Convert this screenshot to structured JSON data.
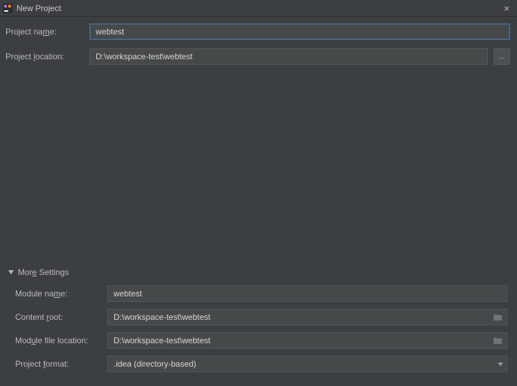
{
  "window": {
    "title": "New Project",
    "close_label": "×"
  },
  "form": {
    "project_name_label_pre": "Project na",
    "project_name_label_u": "m",
    "project_name_label_post": "e:",
    "project_name_value": "webtest",
    "project_location_label_pre": "Project ",
    "project_location_label_u": "l",
    "project_location_label_post": "ocation:",
    "project_location_value": "D:\\workspace-test\\webtest",
    "browse_label": "..."
  },
  "more": {
    "header_pre": "Mor",
    "header_u": "e",
    "header_post": " Settings",
    "module_name_label_pre": "Module na",
    "module_name_label_u": "m",
    "module_name_label_post": "e:",
    "module_name_value": "webtest",
    "content_root_label_pre": "Content ",
    "content_root_label_u": "r",
    "content_root_label_post": "oot:",
    "content_root_value": "D:\\workspace-test\\webtest",
    "module_file_loc_label_pre": "Mod",
    "module_file_loc_label_u": "u",
    "module_file_loc_label_post": "le file location:",
    "module_file_loc_value": "D:\\workspace-test\\webtest",
    "project_format_label_pre": "Project ",
    "project_format_label_u": "f",
    "project_format_label_post": "ormat:",
    "project_format_value": ".idea (directory-based)"
  },
  "icons": {
    "folder": "folder-icon",
    "close": "close-icon",
    "app": "app-icon"
  }
}
